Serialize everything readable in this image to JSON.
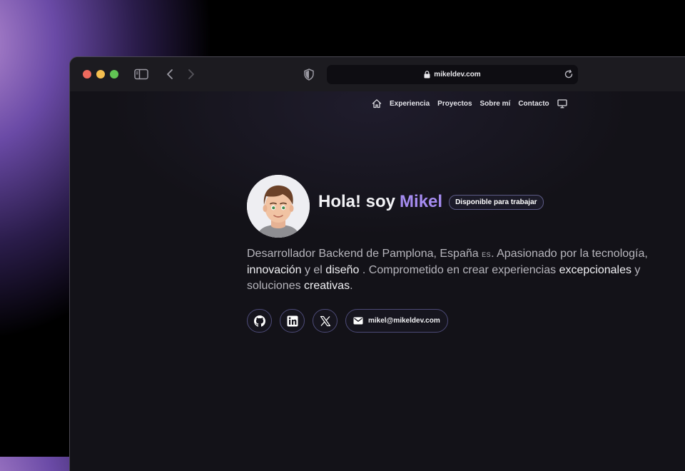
{
  "browser": {
    "url": "mikeldev.com",
    "icons": [
      "sidebar-icon",
      "back-icon",
      "forward-icon",
      "shield-icon",
      "lock-icon",
      "reload-icon"
    ]
  },
  "nav": {
    "items": [
      "Experiencia",
      "Proyectos",
      "Sobre mí",
      "Contacto"
    ]
  },
  "hero": {
    "greeting": "Hola! soy",
    "name": "Mikel",
    "badge": "Disponible para trabajar",
    "bio": {
      "p1": "Desarrollador Backend de Pamplona, España",
      "flag": "ES",
      "p2": ". Apasionado por la tecnología,",
      "h1": "innovación",
      "p3": " y el ",
      "h2": "diseño",
      "p4": " . Comprometido en crear experiencias ",
      "h3": "excepcionales",
      "p5": " y soluciones ",
      "h4": "creativas",
      "p6": "."
    },
    "email": "mikel@mikeldev.com"
  },
  "colors": {
    "accent": "#a58cf0",
    "badge_border": "#5c5a85"
  }
}
